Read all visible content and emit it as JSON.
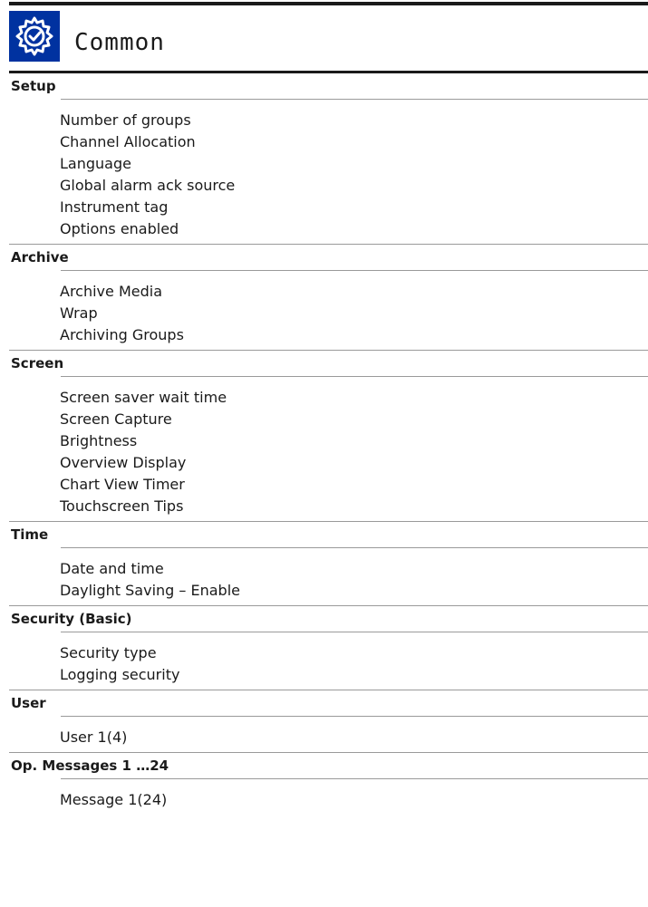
{
  "header": {
    "title": "Common",
    "icon": "gear-check-icon"
  },
  "colors": {
    "icon_background": "#0032a0",
    "rule": "#9a9a9a",
    "text": "#1a1a1a"
  },
  "sections": [
    {
      "title": "Setup",
      "items": [
        "Number of groups",
        "Channel Allocation",
        "Language",
        "Global alarm ack source",
        "Instrument tag",
        "Options enabled"
      ]
    },
    {
      "title": "Archive",
      "items": [
        "Archive Media",
        "Wrap",
        "Archiving Groups"
      ]
    },
    {
      "title": "Screen",
      "items": [
        "Screen saver wait time",
        "Screen Capture",
        "Brightness",
        "Overview Display",
        "Chart View Timer",
        "Touchscreen Tips"
      ]
    },
    {
      "title": "Time",
      "items": [
        "Date and time",
        "Daylight Saving – Enable"
      ]
    },
    {
      "title": "Security (Basic)",
      "items": [
        "Security type",
        "Logging security"
      ]
    },
    {
      "title": "User",
      "items": [
        "User 1(4)"
      ]
    },
    {
      "title": "Op. Messages 1 …24",
      "items": [
        "Message 1(24)"
      ]
    }
  ]
}
